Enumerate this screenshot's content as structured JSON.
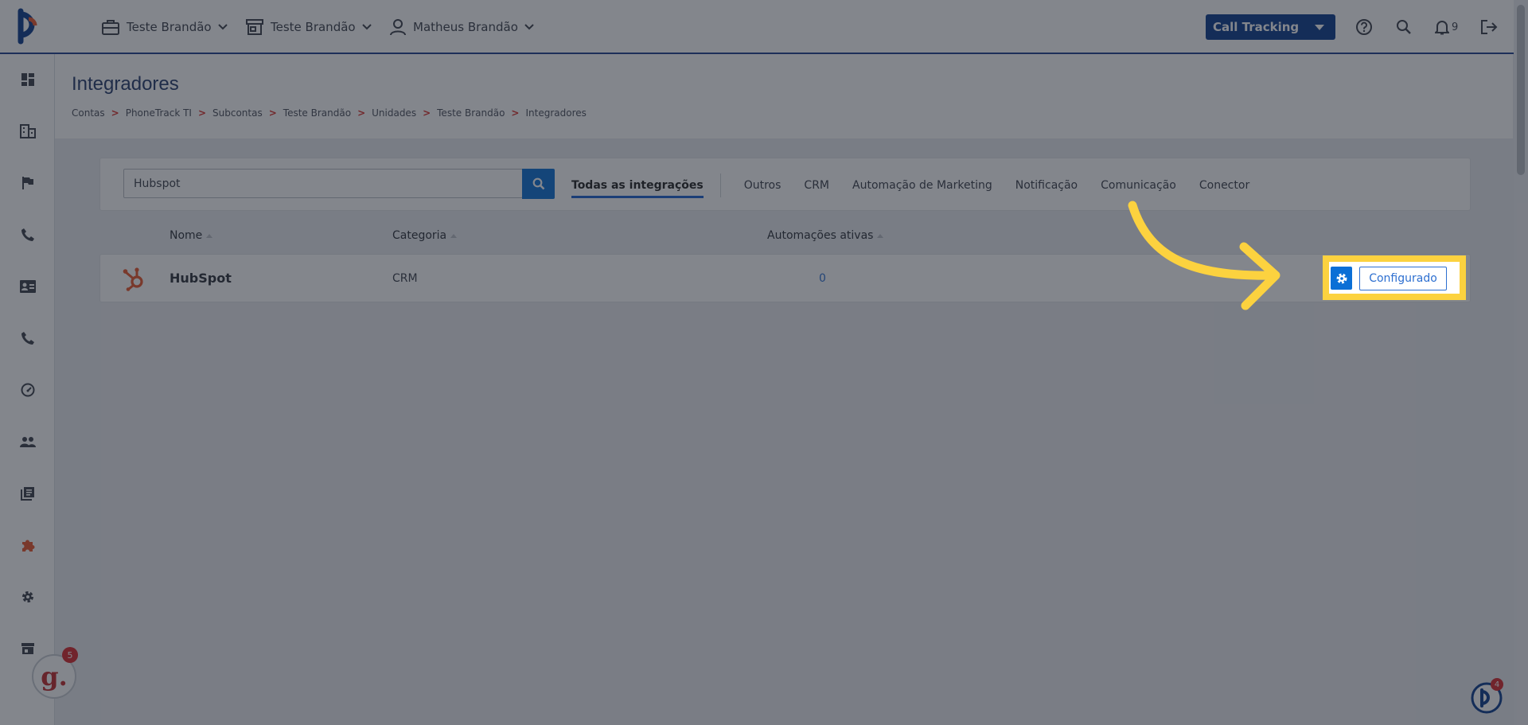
{
  "header": {
    "account_selector": "Teste Brandão",
    "unit_selector": "Teste Brandão",
    "user_selector": "Matheus Brandão",
    "product_switch": "Call Tracking",
    "notifications_count": "9"
  },
  "page": {
    "title": "Integradores",
    "breadcrumb": [
      "Contas",
      "PhoneTrack TI",
      "Subcontas",
      "Teste Brandão",
      "Unidades",
      "Teste Brandão",
      "Integradores"
    ],
    "breadcrumb_separator": ">"
  },
  "filters": {
    "search_value": "Hubspot",
    "tabs": [
      {
        "label": "Todas as integrações",
        "active": true
      },
      {
        "label": "Outros"
      },
      {
        "label": "CRM"
      },
      {
        "label": "Automação de Marketing"
      },
      {
        "label": "Notificação"
      },
      {
        "label": "Comunicação"
      },
      {
        "label": "Conector"
      }
    ]
  },
  "table": {
    "columns": [
      "Nome",
      "Categoria",
      "Automações ativas"
    ],
    "rows": [
      {
        "name": "HubSpot",
        "category": "CRM",
        "active_automations": "0",
        "status_label": "Configurado"
      }
    ]
  },
  "widgets": {
    "g_badge": "5",
    "p_badge": "4"
  },
  "colors": {
    "primary": "#0b6fd6",
    "navy": "#0a3b8c",
    "highlight": "#fcd23f",
    "hubspot": "#e8562a"
  }
}
